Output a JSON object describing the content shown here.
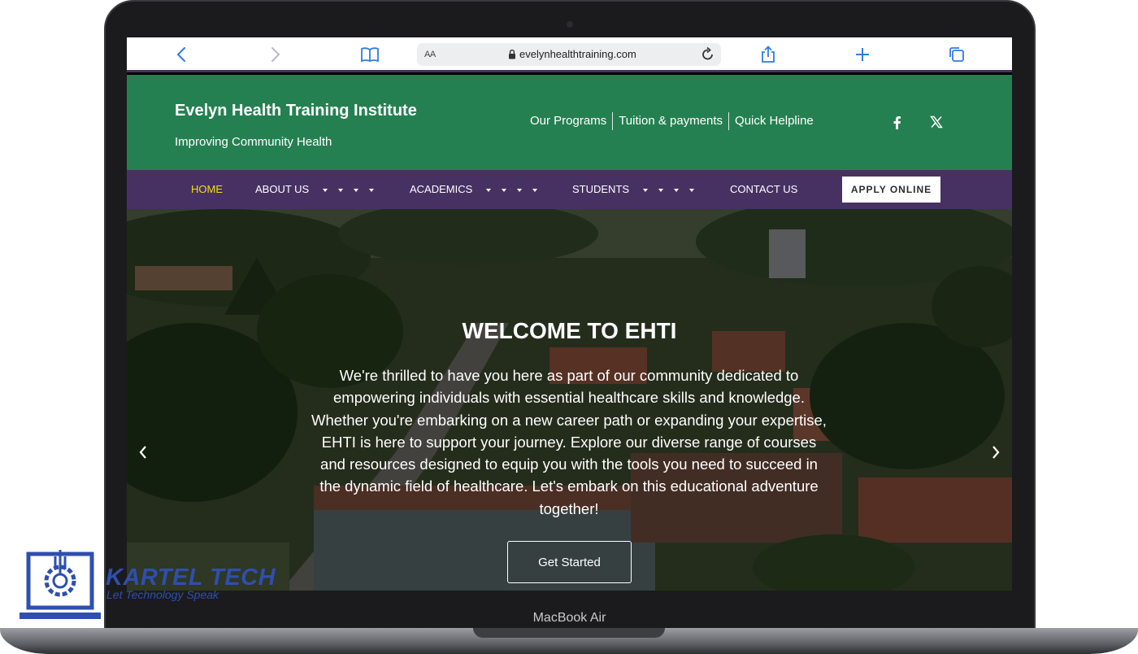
{
  "device": {
    "label": "MacBook Air"
  },
  "browser": {
    "url": "evelynhealthtraining.com",
    "text_size_label": "AA",
    "icons": [
      "back-icon",
      "forward-icon",
      "bookmarks-icon",
      "lock-icon",
      "reload-icon",
      "share-icon",
      "new-tab-icon",
      "tabs-icon"
    ]
  },
  "site": {
    "title": "Evelyn Health Training Institute",
    "tagline": "Improving Community Health",
    "top_links": [
      "Our Programs",
      "Tuition & payments",
      "Quick Helpline"
    ],
    "social": [
      "facebook-icon",
      "x-icon"
    ],
    "colors": {
      "header_green": "#258051",
      "nav_purple": "#473162",
      "active_nav": "#f3dc1b"
    }
  },
  "nav": {
    "items": [
      {
        "label": "HOME"
      },
      {
        "label": "ABOUT US"
      },
      {
        "label": "ACADEMICS"
      },
      {
        "label": "STUDENTS"
      },
      {
        "label": "CONTACT US"
      }
    ],
    "apply_label": "APPLY ONLINE"
  },
  "hero": {
    "title": "WELCOME TO EHTI",
    "text": "We're thrilled to have you here as part of our community dedicated to empowering individuals with essential healthcare skills and knowledge. Whether you're embarking on a new career path or expanding your expertise, EHTI is here to support your journey. Explore our diverse range of courses and resources designed to equip you with the tools you need to succeed in the dynamic field of healthcare. Let's embark on this educational adventure together!",
    "button_label": "Get Started"
  },
  "watermark": {
    "name": "KARTEL TECH",
    "tagline": "Let Technology Speak"
  }
}
